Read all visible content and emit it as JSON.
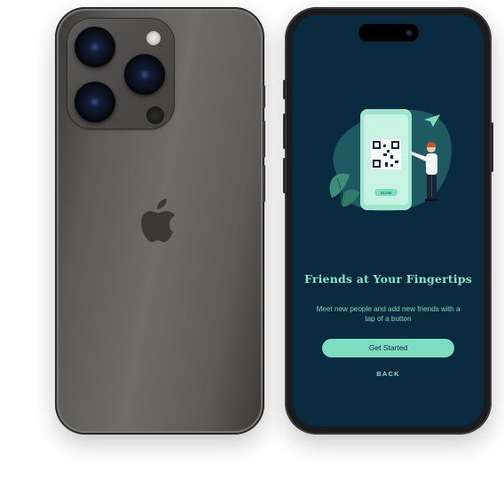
{
  "onboarding": {
    "title": "Friends at Your Fingertips",
    "subtitle": "Meet new people and add new friends with a tap of a button",
    "primary_button_label": "Get Started",
    "back_label": "BACK",
    "illustration_button_label": "SCAN",
    "illustration_icons": [
      "qr-code-icon",
      "paper-plane-icon",
      "person-icon",
      "leaf-icon"
    ]
  },
  "colors": {
    "screen_background": "#0a2a40",
    "accent": "#7edcc0",
    "phone_back_body": "#5e5c5a",
    "phone_front_frame": "#1b1b1d"
  }
}
